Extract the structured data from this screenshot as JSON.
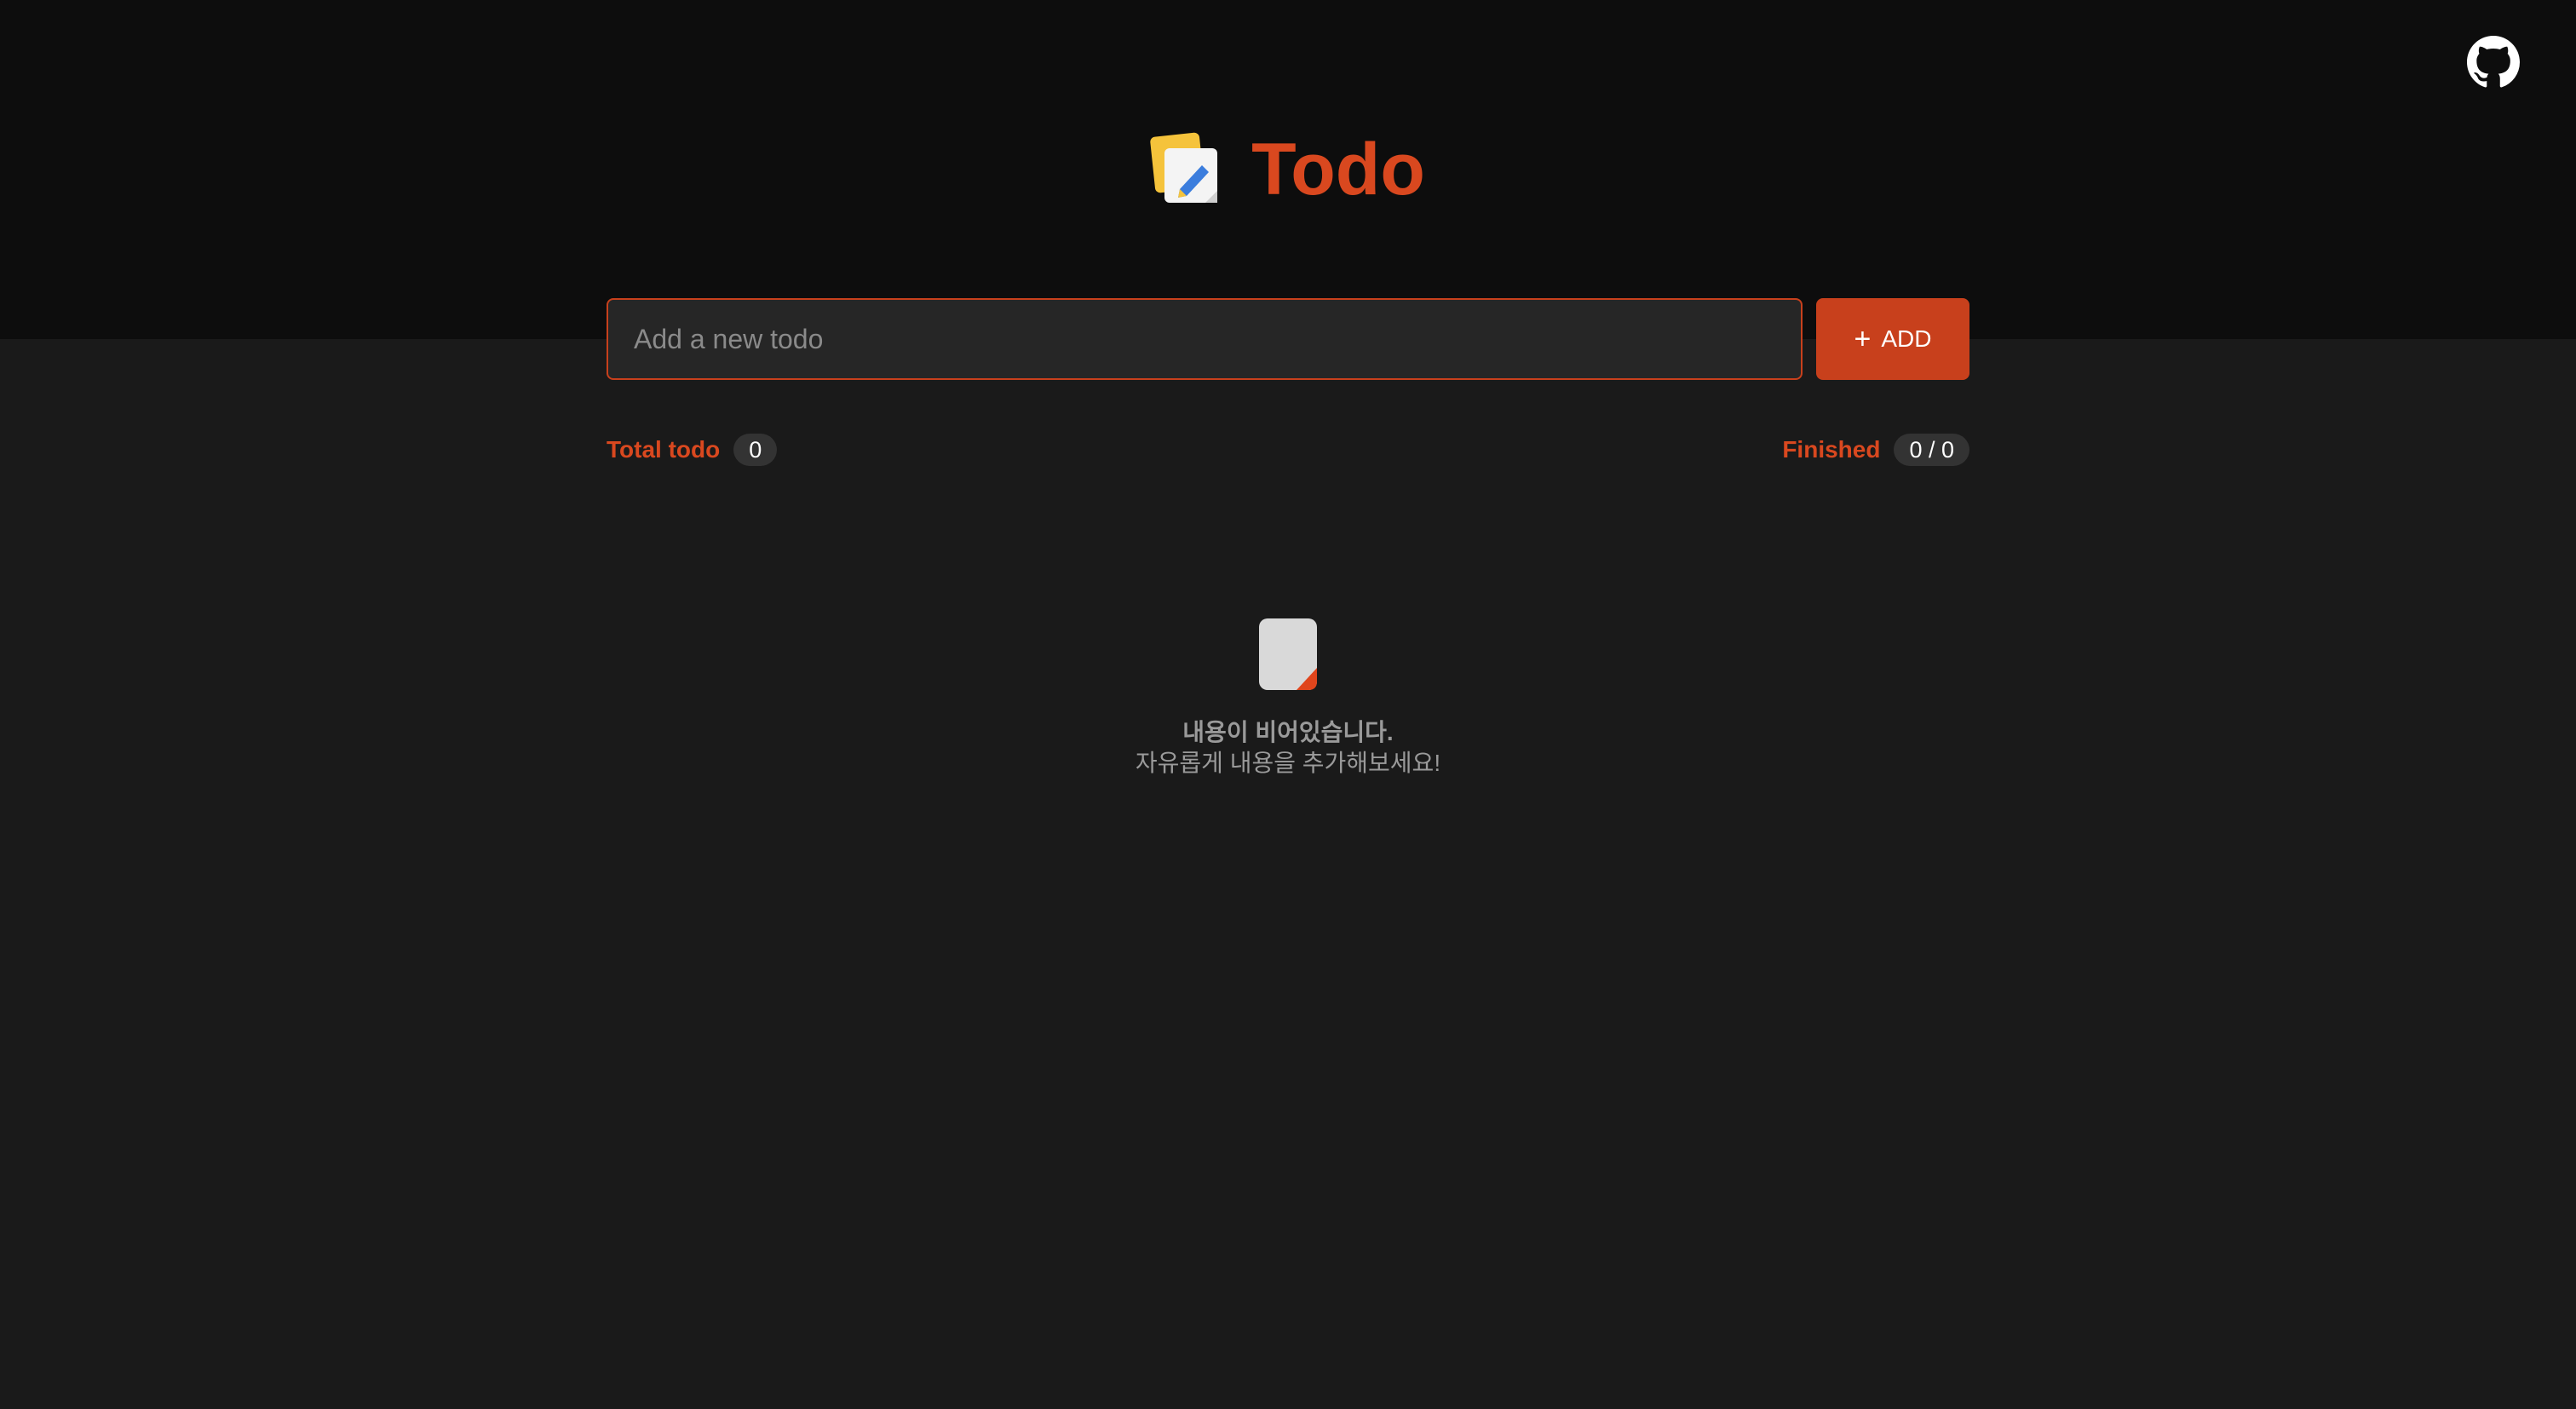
{
  "header": {
    "app_title": "Todo",
    "logo_icon": "memo-pencil-icon",
    "github_icon": "github-icon"
  },
  "form": {
    "input_value": "",
    "input_placeholder": "Add a new todo",
    "add_label": "ADD",
    "add_icon": "plus-icon"
  },
  "stats": {
    "total_label": "Total todo",
    "total_count": "0",
    "finished_label": "Finished",
    "finished_count": "0 / 0"
  },
  "empty_state": {
    "icon": "document-icon",
    "title": "내용이 비어있습니다.",
    "subtitle": "자유롭게 내용을 추가해보세요!"
  },
  "colors": {
    "accent": "#d9481f",
    "header_background": "#0d0d0d",
    "page_background": "#1a1a1a"
  }
}
